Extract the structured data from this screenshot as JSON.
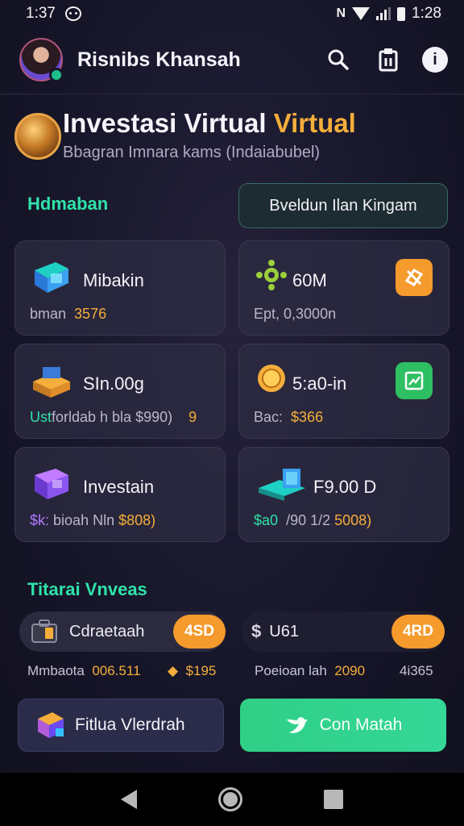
{
  "status_bar": {
    "time": "1:37",
    "clock_right": "1:28",
    "nfc_label": "N"
  },
  "header": {
    "title": "Risnibs Khansah",
    "help_symbol": "i"
  },
  "hero": {
    "title_main": "Investasi Virtual",
    "title_accent": "Virtual",
    "subtitle": "Bbagran Imnara kams (Indaiabubel)"
  },
  "section": {
    "label": "Hdmaban",
    "button_label": "Bveldun Ilan Kingam"
  },
  "cards": [
    {
      "title": "Mibakin",
      "sub_label": "bman",
      "sub_value": "3576"
    },
    {
      "title": "60M",
      "sub_label": "Ept, 0,3000n",
      "sub_value": ""
    },
    {
      "title": "SIn.00g",
      "sub_prefix": "Ust",
      "sub_label": "forldab h bla $990)",
      "sub_value": "9"
    },
    {
      "title": "5:a0-in",
      "sub_label": "Bac:",
      "sub_value": "$366"
    },
    {
      "title": "Investain",
      "sub_prefix": "$k:",
      "sub_label": "bioah Nln",
      "sub_value": "$808)"
    },
    {
      "title": "F9.00 D",
      "sub_prefix": "$a0",
      "sub_label": "/90 1/2",
      "sub_value": "5008)"
    }
  ],
  "section2": {
    "label": "Titarai Vnveas"
  },
  "assets": [
    {
      "name": "Cdraetaah",
      "tag": "4SD"
    },
    {
      "name": "U61",
      "tag": "4RD"
    }
  ],
  "stats": [
    {
      "label": "Mmbaota",
      "value": "006.511"
    },
    {
      "label": "",
      "value": "$195"
    },
    {
      "label": "Poeioan lah",
      "value": "2090"
    },
    {
      "label": "4i365",
      "value": ""
    }
  ],
  "actions": {
    "left_label": "Fitlua Vlerdrah",
    "right_label": "Con Matah"
  },
  "colors": {
    "accent_green": "#2fe3a8",
    "accent_orange": "#f5ae3b",
    "background": "#17162a"
  }
}
